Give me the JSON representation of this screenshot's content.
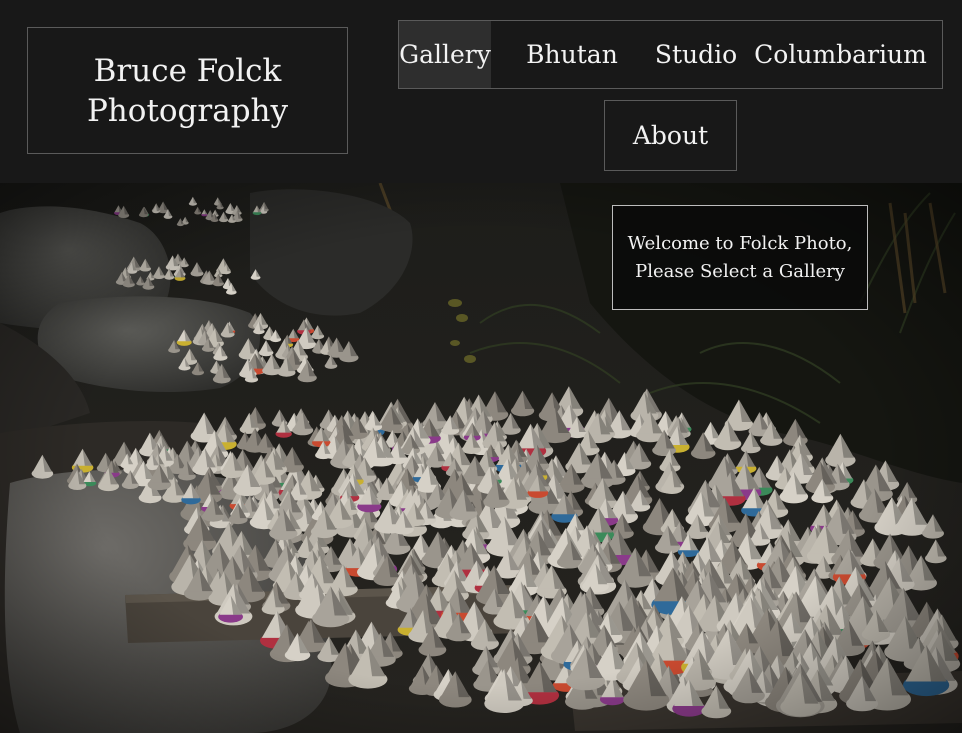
{
  "site": {
    "brand_line1": "Bruce Folck",
    "brand_line2": "Photography"
  },
  "nav": {
    "items": [
      {
        "label": "Gallery",
        "active": true
      },
      {
        "label": "Bhutan",
        "active": false
      },
      {
        "label": "Studio",
        "active": false
      },
      {
        "label": "Columbarium",
        "active": false
      },
      {
        "label": "About",
        "active": false
      }
    ]
  },
  "hero": {
    "welcome_line1": "Welcome to Folck Photo,",
    "welcome_line2": "Please Select a Gallery",
    "image_description_icon": "tsa-tsa-offerings-photo"
  },
  "colors": {
    "header_bg": "#181818",
    "border": "#5a5a5a",
    "active_tab_bg": "#2e2e2e",
    "text": "#f2f2f2"
  }
}
